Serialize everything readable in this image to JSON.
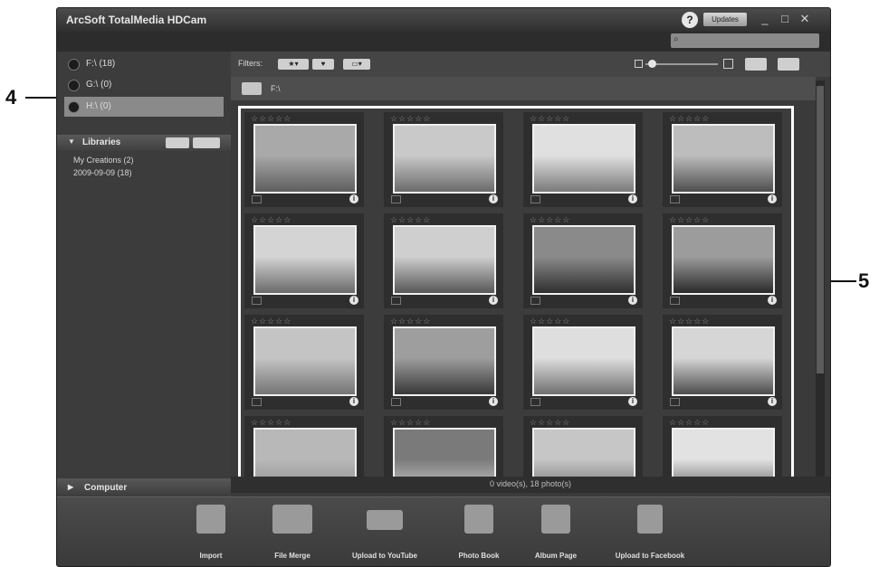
{
  "window": {
    "title": "ArcSoft TotalMedia HDCam",
    "updates_label": "Updates",
    "help_glyph": "?",
    "minimize_glyph": "_",
    "maximize_glyph": "□",
    "close_glyph": "✕"
  },
  "search": {
    "placeholder": ""
  },
  "drives": [
    {
      "label": "F:\\ (18)"
    },
    {
      "label": "G:\\ (0)"
    },
    {
      "label": "H:\\ (0)"
    }
  ],
  "libraries": {
    "header": "Libraries",
    "items": [
      "My Creations (2)",
      "2009-09-09 (18)"
    ]
  },
  "computer": {
    "header": "Computer"
  },
  "filters": {
    "label": "Filters:",
    "star_btn": "★▾",
    "fav_btn": "♥",
    "type_btn": "▭▾"
  },
  "path": {
    "text": "F:\\"
  },
  "gallery": {
    "rating_glyphs": "☆☆☆☆☆",
    "info_glyph": "i",
    "thumbnail_icons": [
      "image-thumbnail-icon"
    ],
    "tile_count": 16
  },
  "status": {
    "text": "0 video(s), 18 photo(s)"
  },
  "taskbar": [
    {
      "label": "Import",
      "icon": "import-icon"
    },
    {
      "label": "File Merge",
      "icon": "file-merge-icon"
    },
    {
      "label": "Upload to YouTube",
      "icon": "youtube-icon"
    },
    {
      "label": "Photo Book",
      "icon": "photo-book-icon"
    },
    {
      "label": "Album Page",
      "icon": "album-page-icon"
    },
    {
      "label": "Upload to Facebook",
      "icon": "facebook-icon"
    }
  ],
  "callouts": {
    "left": "4",
    "right": "5"
  },
  "colors": {
    "accent": "#ffffff",
    "panel": "#3a3a3a"
  }
}
